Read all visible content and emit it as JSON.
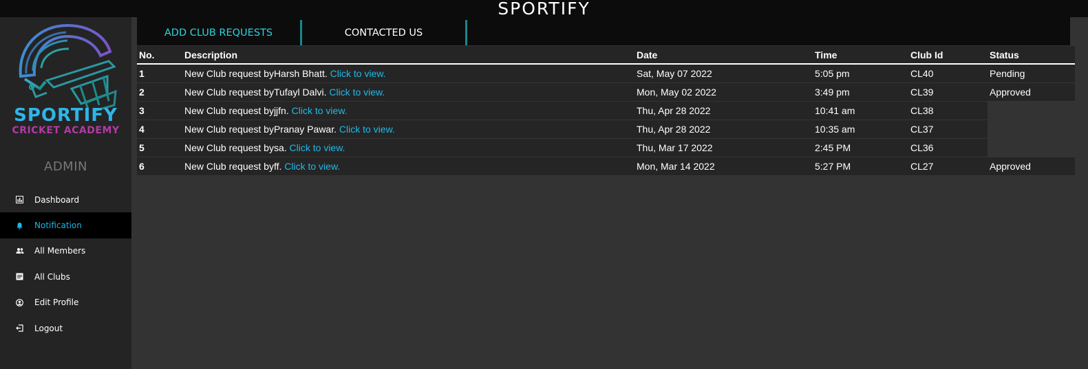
{
  "header": {
    "title": "SPORTIFY"
  },
  "sidebar": {
    "logo_line1": "SPORTIFY",
    "logo_line2": "CRICKET ACADEMY",
    "role": "ADMIN",
    "items": [
      {
        "label": "Dashboard",
        "icon": "dashboard-icon",
        "active": false
      },
      {
        "label": "Notification",
        "icon": "bell-icon",
        "active": true
      },
      {
        "label": "All Members",
        "icon": "users-icon",
        "active": false
      },
      {
        "label": "All Clubs",
        "icon": "list-icon",
        "active": false
      },
      {
        "label": "Edit Profile",
        "icon": "user-circle-icon",
        "active": false
      },
      {
        "label": "Logout",
        "icon": "logout-icon",
        "active": false
      }
    ]
  },
  "tabs": [
    {
      "label": "ADD CLUB REQUESTS",
      "active": true
    },
    {
      "label": "CONTACTED US",
      "active": false
    }
  ],
  "table": {
    "headers": [
      "No.",
      "Description",
      "Date",
      "Time",
      "Club Id",
      "Status"
    ],
    "link_text": "Click to view.",
    "rows": [
      {
        "no": "1",
        "desc": "New Club request byHarsh Bhatt.",
        "date": "Sat, May 07 2022",
        "time": "5:05 pm",
        "club": "CL40",
        "status": "Pending"
      },
      {
        "no": "2",
        "desc": "New Club request byTufayl Dalvi.",
        "date": "Mon, May 02 2022",
        "time": "3:49 pm",
        "club": "CL39",
        "status": "Approved"
      },
      {
        "no": "3",
        "desc": "New Club request byjjfn.",
        "date": "Thu, Apr 28 2022",
        "time": "10:41 am",
        "club": "CL38",
        "status": ""
      },
      {
        "no": "4",
        "desc": "New Club request byPranay Pawar.",
        "date": "Thu, Apr 28 2022",
        "time": "10:35 am",
        "club": "CL37",
        "status": ""
      },
      {
        "no": "5",
        "desc": "New Club request bysa.",
        "date": "Thu, Mar 17 2022",
        "time": "2:45 PM",
        "club": "CL36",
        "status": ""
      },
      {
        "no": "6",
        "desc": "New Club request byff.",
        "date": "Mon, Mar 14 2022",
        "time": "5:27 PM",
        "club": "CL27",
        "status": "Approved"
      }
    ]
  },
  "colors": {
    "accent": "#21b9e8",
    "tab_divider": "#16888f",
    "active_tab": "#2dd3df",
    "logo_blue": "#2fb5e8",
    "logo_magenta": "#b23aa6"
  }
}
